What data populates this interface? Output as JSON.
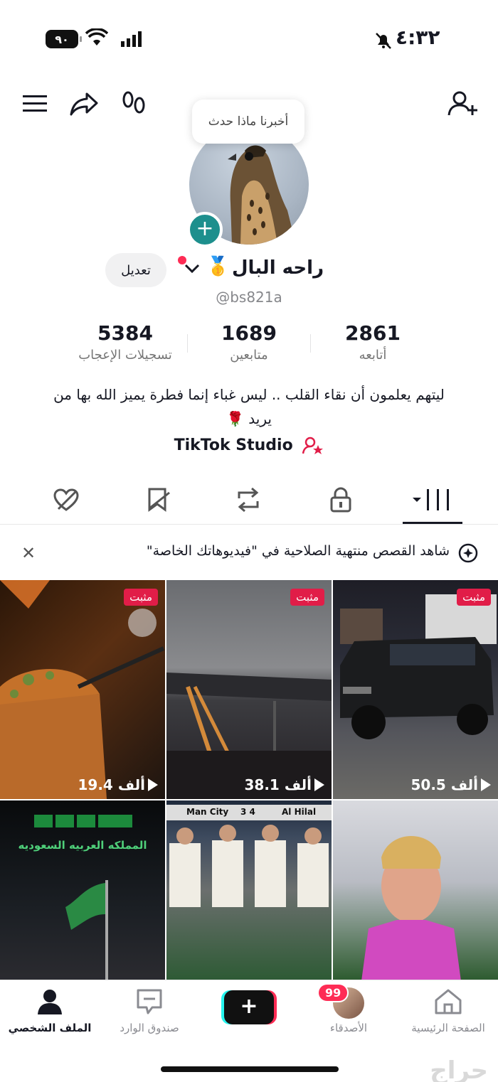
{
  "status_bar": {
    "time": "٤:٣٢",
    "battery": "٩٠"
  },
  "tooltip": "أخبرنا ماذا حدث",
  "profile": {
    "display_name": "راحه البال",
    "username": "@bs821a",
    "edit_label": "تعديل",
    "stats": [
      {
        "value": "2861",
        "label": "أتابعه"
      },
      {
        "value": "1689",
        "label": "متابعين"
      },
      {
        "value": "5384",
        "label": "تسجيلات الإعجاب"
      }
    ],
    "bio": "ليتهم يعلمون أن نقاء القلب .. ليس غباء إنما فطرة يميز الله بها من يريد 🌹",
    "studio_link": "TikTok Studio"
  },
  "tabs": [
    "videos",
    "private",
    "reposts",
    "favorites",
    "liked"
  ],
  "banner": {
    "text": "شاهد القصص منتهية الصلاحية في \"فيديوهاتك الخاصة\""
  },
  "videos": [
    {
      "pinned": "مثبت",
      "views": "50.5 ألف"
    },
    {
      "pinned": "مثبت",
      "views": "38.1 ألف"
    },
    {
      "pinned": "مثبت",
      "views": "19.4 ألف"
    },
    {
      "overlay": ""
    },
    {
      "overlay_top_left": "Man City",
      "overlay_score": "3  4",
      "overlay_top_right": "Al Hilal"
    },
    {
      "overlay_top": "المملكه العربيه السعوديه"
    }
  ],
  "bottom_nav": {
    "home": "الصفحة الرئيسية",
    "friends": "الأصدقاء",
    "friends_badge": "99",
    "inbox": "صندوق الوارد",
    "profile": "الملف الشخصي"
  },
  "watermark": "حراج"
}
